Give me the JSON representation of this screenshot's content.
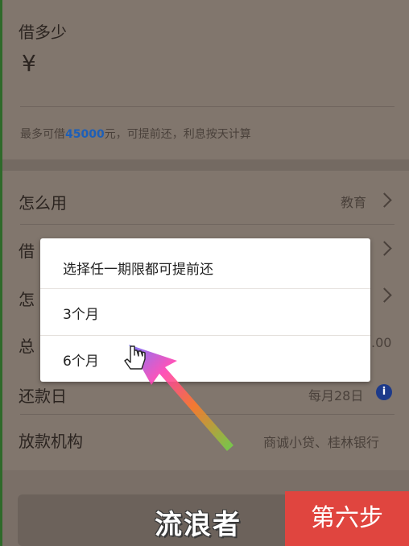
{
  "borrow": {
    "title": "借多少",
    "currency_symbol": "¥",
    "limit_prefix": "最多可借",
    "limit_amount": "45000",
    "limit_suffix": "元，可提前还，利息按天计算"
  },
  "rows": {
    "usage_label": "怎么用",
    "usage_value": "教育",
    "borrow_label_partial": "借",
    "how_label_partial": "怎",
    "total_label_partial": "总",
    "total_value_partial": ".00",
    "repay_day_label": "还款日",
    "repay_day_value": "每月28日",
    "info_icon_glyph": "i",
    "lender_label": "放款机构",
    "lender_value": "商诚小贷、桂林银行"
  },
  "dialog": {
    "header": "选择任一期限都可提前还",
    "options": [
      "3个月",
      "6个月"
    ]
  },
  "overlay": {
    "watermark": "流浪者",
    "step_label": "第六步"
  },
  "colors": {
    "accent_blue": "#1d5fb8",
    "step_red": "#e0453f"
  }
}
